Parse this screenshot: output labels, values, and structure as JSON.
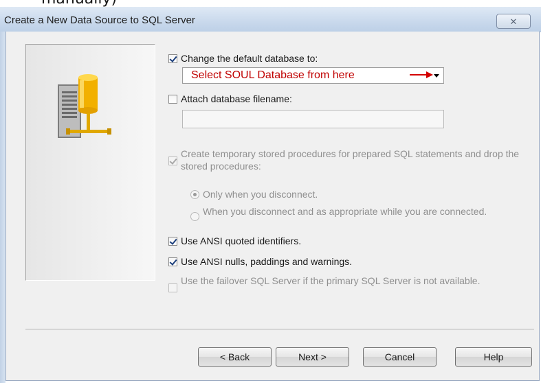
{
  "caption_fragment": "manually)",
  "window": {
    "title": "Create a New Data Source to SQL Server",
    "close_glyph": "✕"
  },
  "options": {
    "change_default_db": {
      "label": "Change the default database to:",
      "checked": true
    },
    "database_combo": {
      "value": "Select SOUL Database from here"
    },
    "attach_filename": {
      "label": "Attach database filename:",
      "checked": false,
      "value": ""
    },
    "temp_procs": {
      "label": "Create temporary stored procedures for prepared SQL statements and drop the stored procedures:",
      "checked": true,
      "enabled": false
    },
    "radio_disconnect": {
      "label": "Only when you disconnect.",
      "selected": true
    },
    "radio_appropriate": {
      "label": "When you disconnect and as appropriate while you are connected.",
      "selected": false
    },
    "ansi_quoted": {
      "label": "Use ANSI quoted identifiers.",
      "checked": true
    },
    "ansi_nulls": {
      "label": "Use ANSI nulls, paddings and warnings.",
      "checked": true
    },
    "failover": {
      "label": "Use the failover SQL Server if the primary SQL Server is not available.",
      "checked": false,
      "enabled": false
    }
  },
  "buttons": {
    "back": "< Back",
    "next": "Next >",
    "cancel": "Cancel",
    "help": "Help"
  },
  "icons": {
    "server": "database-server-icon",
    "annotation_arrow": "red-arrow-icon",
    "dropdown": "chevron-down-icon"
  },
  "colors": {
    "annotation_red": "#c00000",
    "check_blue": "#1c3f7c"
  }
}
